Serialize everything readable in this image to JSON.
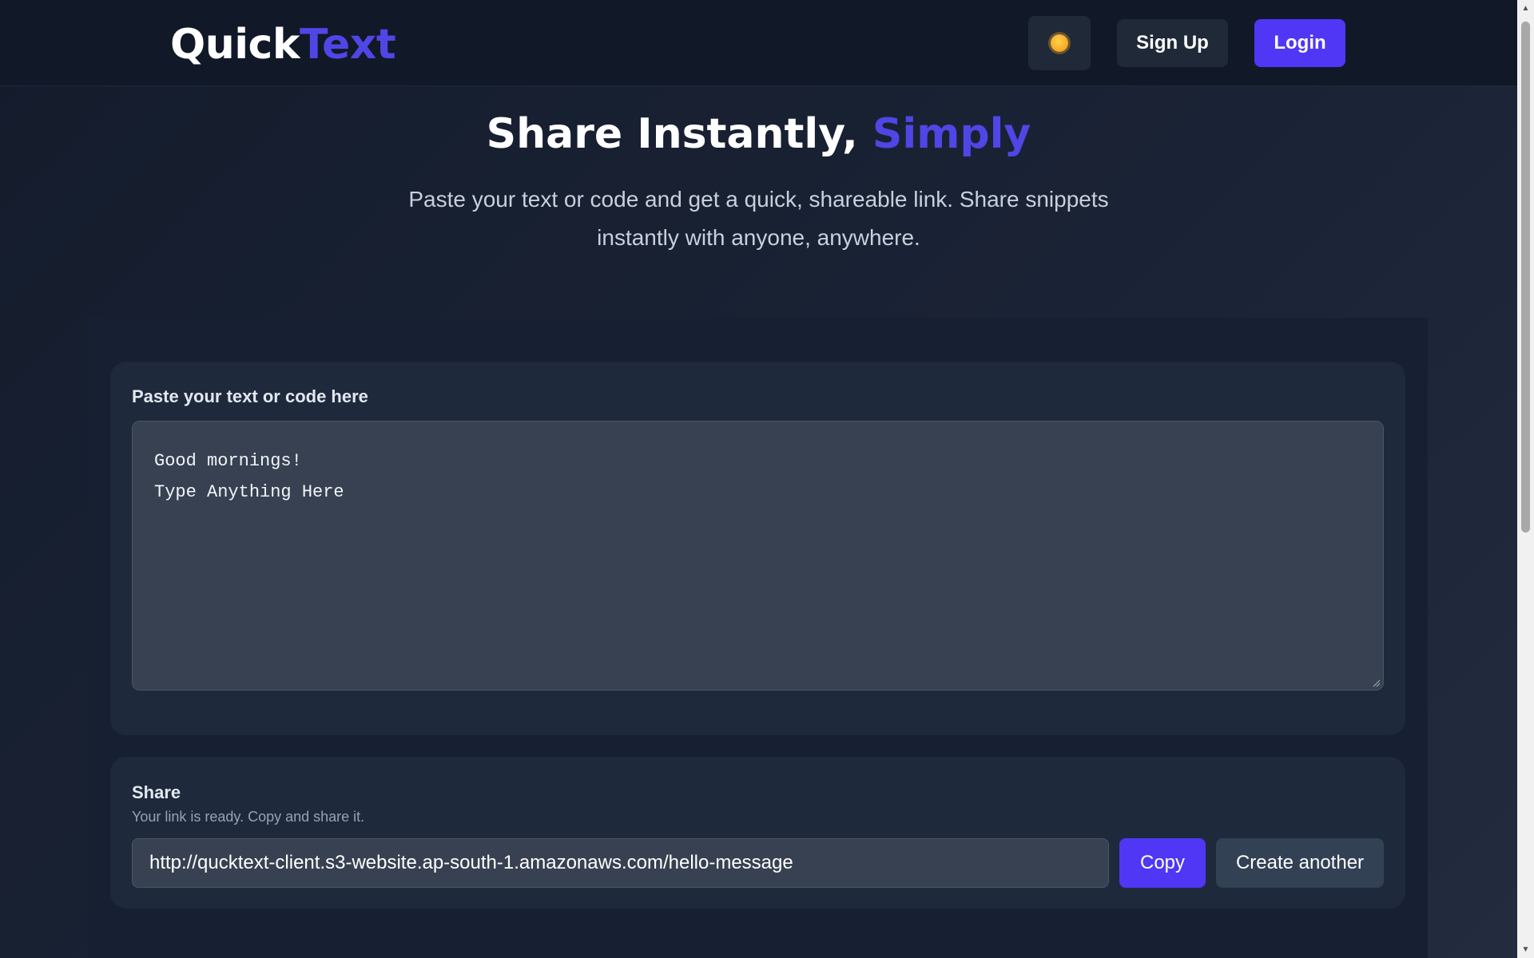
{
  "header": {
    "logo_part1": "Quick",
    "logo_part2": "Text",
    "theme_icon": "sun-icon",
    "signup_label": "Sign Up",
    "login_label": "Login"
  },
  "hero": {
    "title_part1": "Share Instantly, ",
    "title_part2": "Simply",
    "subtitle": "Paste your text or code and get a quick, shareable link. Share snippets instantly with anyone, anywhere."
  },
  "editor": {
    "label": "Paste your text or code here",
    "content": "Good mornings!\nType Anything Here"
  },
  "share": {
    "title": "Share",
    "subtitle": "Your link is ready. Copy and share it.",
    "link": "http://qucktext-client.s3-website.ap-south-1.amazonaws.com/hello-message",
    "copy_label": "Copy",
    "create_another_label": "Create another"
  },
  "colors": {
    "accent": "#4f37f5",
    "brand_text": "#4f46e5",
    "background": "#141c2c",
    "card": "#1e293b"
  }
}
